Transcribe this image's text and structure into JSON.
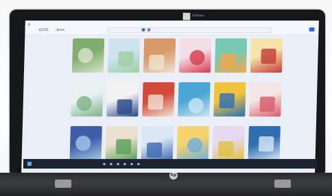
{
  "scene": {
    "description_free": true,
    "camera_text": "Ai-Brown",
    "browser": {
      "logo": "A",
      "nav_left": "VCSD",
      "nav_right": "Bree",
      "search_placeholder": ""
    },
    "brand_logo": "hp",
    "colors": {
      "screen_bg": "#e9eef7",
      "accent": "#2e6fd8",
      "taskbar": "#1d2330"
    },
    "book_covers": [
      {
        "name": "book-cover-1",
        "color": "#7fae6e",
        "color2": "#d8e4c8",
        "label": ""
      },
      {
        "name": "book-cover-2",
        "color": "#cfe3f0",
        "color2": "#9ed0a4",
        "label": ""
      },
      {
        "name": "book-cover-3",
        "color": "#d89a6a",
        "color2": "#f0e2d0",
        "label": ""
      },
      {
        "name": "book-cover-4",
        "color": "#f2dfe6",
        "color2": "#d73a4f",
        "label": ""
      },
      {
        "name": "book-cover-5",
        "color": "#78c8b4",
        "color2": "#f4a84c",
        "label": ""
      },
      {
        "name": "book-cover-6",
        "color": "#f5e3a8",
        "color2": "#c63a3a",
        "label": ""
      },
      {
        "name": "book-cover-7",
        "color": "#e8f0f2",
        "color2": "#7eb38a",
        "label": ""
      },
      {
        "name": "book-cover-8",
        "color": "#f2f2f2",
        "color2": "#2b4a8a",
        "label": ""
      },
      {
        "name": "book-cover-9",
        "color": "#d34a3a",
        "color2": "#f1e2d5",
        "label": ""
      },
      {
        "name": "book-cover-10",
        "color": "#4aa6d4",
        "color2": "#c9e6f4",
        "label": ""
      },
      {
        "name": "book-cover-11",
        "color": "#f0c23e",
        "color2": "#2b6fb8",
        "label": ""
      },
      {
        "name": "book-cover-12",
        "color": "#f3e4e6",
        "color2": "#d95b6a",
        "label": ""
      },
      {
        "name": "book-cover-13",
        "color": "#3e5fa8",
        "color2": "#a5c7e8",
        "label": ""
      },
      {
        "name": "book-cover-14",
        "color": "#e9e0d0",
        "color2": "#5aa05a",
        "label": ""
      },
      {
        "name": "book-cover-15",
        "color": "#dbe7f3",
        "color2": "#3d6ab0",
        "label": ""
      },
      {
        "name": "book-cover-16",
        "color": "#f5d36e",
        "color2": "#6ab0e0",
        "label": ""
      },
      {
        "name": "book-cover-17",
        "color": "#e7d9f0",
        "color2": "#e0c040",
        "label": ""
      },
      {
        "name": "book-cover-18",
        "color": "#2f6fb0",
        "color2": "#d8e8f8",
        "label": ""
      }
    ],
    "taskbar": {
      "icons": "▪ ▪ ▪ ▪ ▪ ▪",
      "tray": ""
    }
  }
}
